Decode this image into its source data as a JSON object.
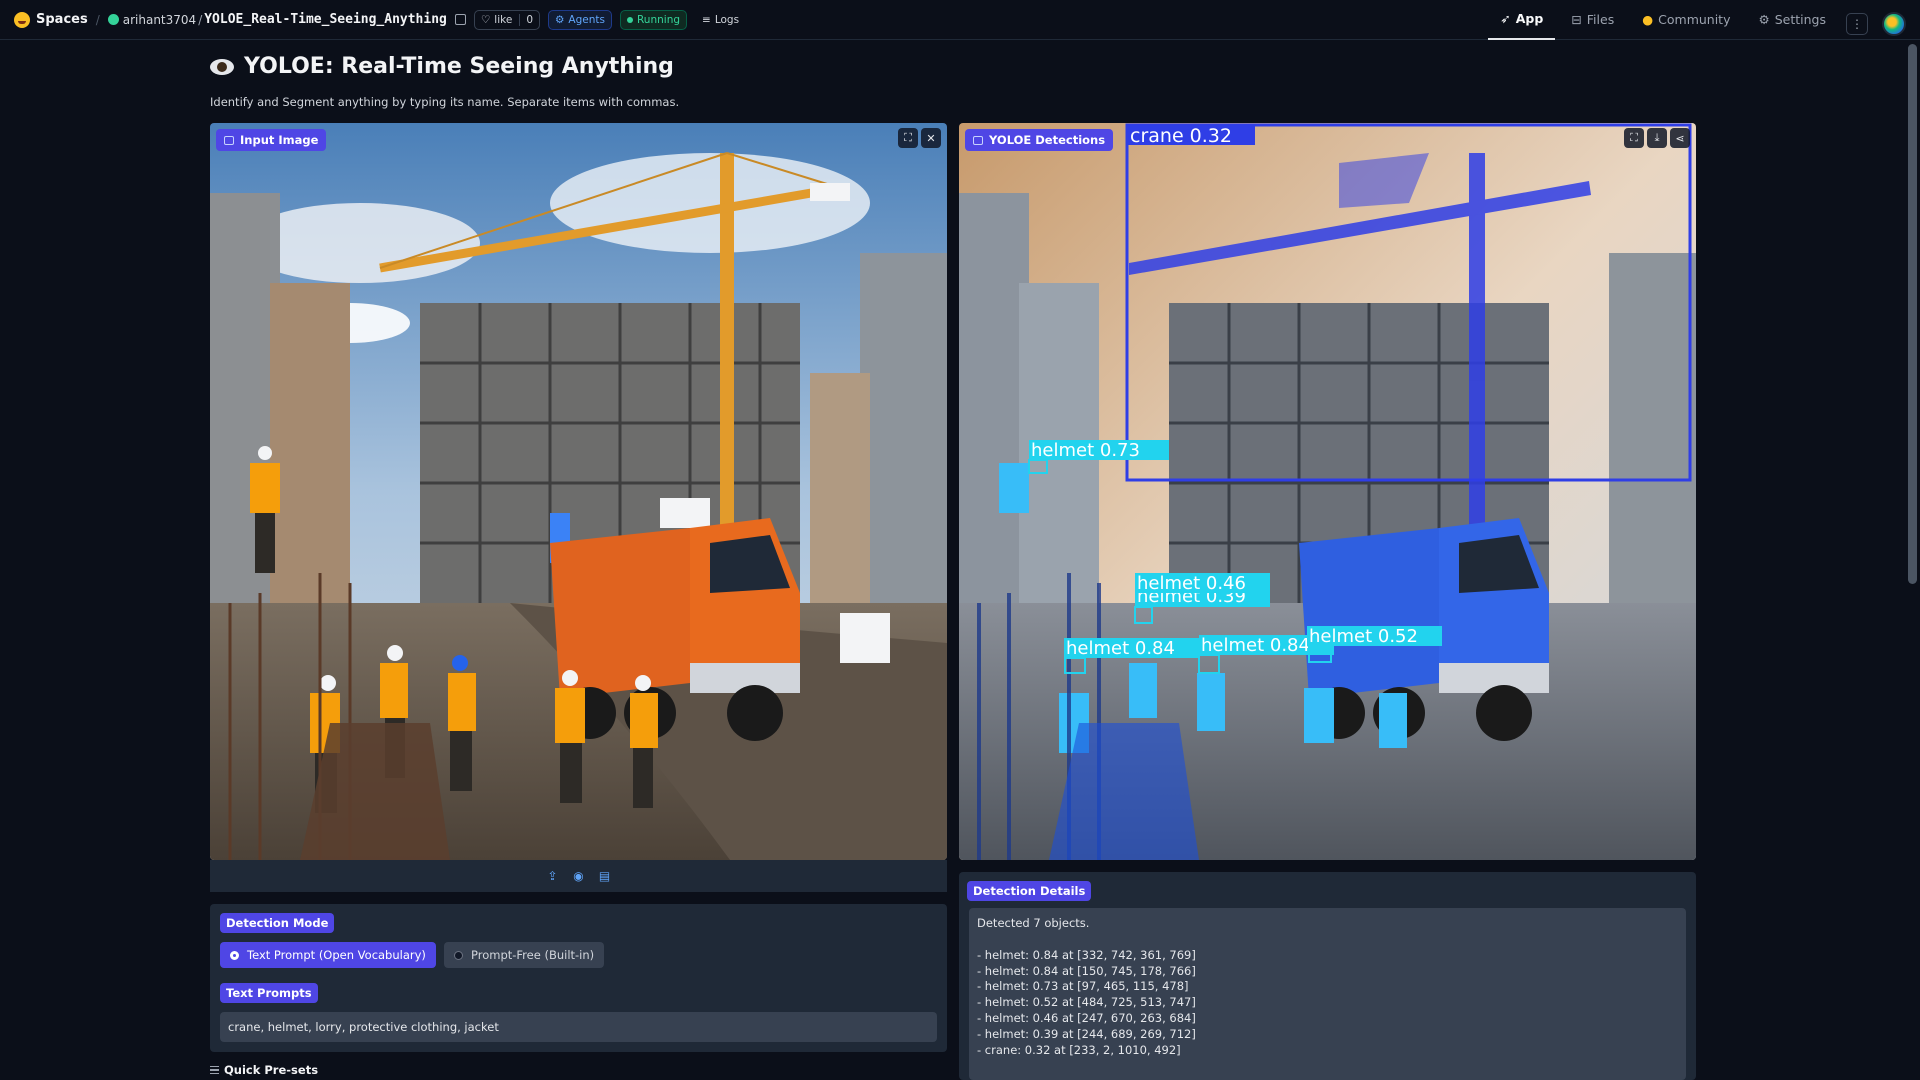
{
  "topbar": {
    "brand": "Spaces",
    "owner": "arihant3704",
    "repo": "YOLOE_Real-Time_Seeing_Anything",
    "like_label": "like",
    "like_count": "0",
    "agents_label": "Agents",
    "status_label": "Running",
    "logs_label": "Logs",
    "nav": {
      "app": "App",
      "files": "Files",
      "community": "Community",
      "settings": "Settings"
    }
  },
  "header": {
    "title": "YOLOE: Real-Time Seeing Anything",
    "subtitle": "Identify and Segment anything by typing its name. Separate items with commas."
  },
  "input_panel": {
    "label": "Input Image"
  },
  "output_panel": {
    "label": "YOLOE Detections"
  },
  "detections": [
    {
      "label": "crane 0.32",
      "kind": "crane"
    },
    {
      "label": "helmet 0.73",
      "kind": "helmet"
    },
    {
      "label": "helmet 0.46",
      "kind": "helmet"
    },
    {
      "label": "helmet 0.39",
      "kind": "helmet"
    },
    {
      "label": "helmet 0.84",
      "kind": "helmet"
    },
    {
      "label": "helmet 0.84",
      "kind": "helmet"
    },
    {
      "label": "helmet 0.52",
      "kind": "helmet"
    }
  ],
  "controls": {
    "mode_label": "Detection Mode",
    "mode_options": [
      "Text Prompt (Open Vocabulary)",
      "Prompt-Free (Built-in)"
    ],
    "mode_selected": "Text Prompt (Open Vocabulary)",
    "prompts_label": "Text Prompts",
    "prompts_value": "crane, helmet, lorry, protective clothing, jacket",
    "quick_presets_label": "Quick Pre-sets"
  },
  "details": {
    "label": "Detection Details",
    "summary": "Detected 7 objects.",
    "lines": [
      "- helmet: 0.84 at [332, 742, 361, 769]",
      "- helmet: 0.84 at [150, 745, 178, 766]",
      "- helmet: 0.73 at [97, 465, 115, 478]",
      "- helmet: 0.52 at [484, 725, 513, 747]",
      "- helmet: 0.46 at [247, 670, 263, 684]",
      "- helmet: 0.39 at [244, 689, 269, 712]",
      "- crane: 0.32 at [233, 2, 1010, 492]"
    ]
  },
  "colors": {
    "accent": "#4f46e5",
    "background": "#0b0f19",
    "crane_box": "#2f3ee6",
    "helmet_box": "#22d3ee"
  }
}
